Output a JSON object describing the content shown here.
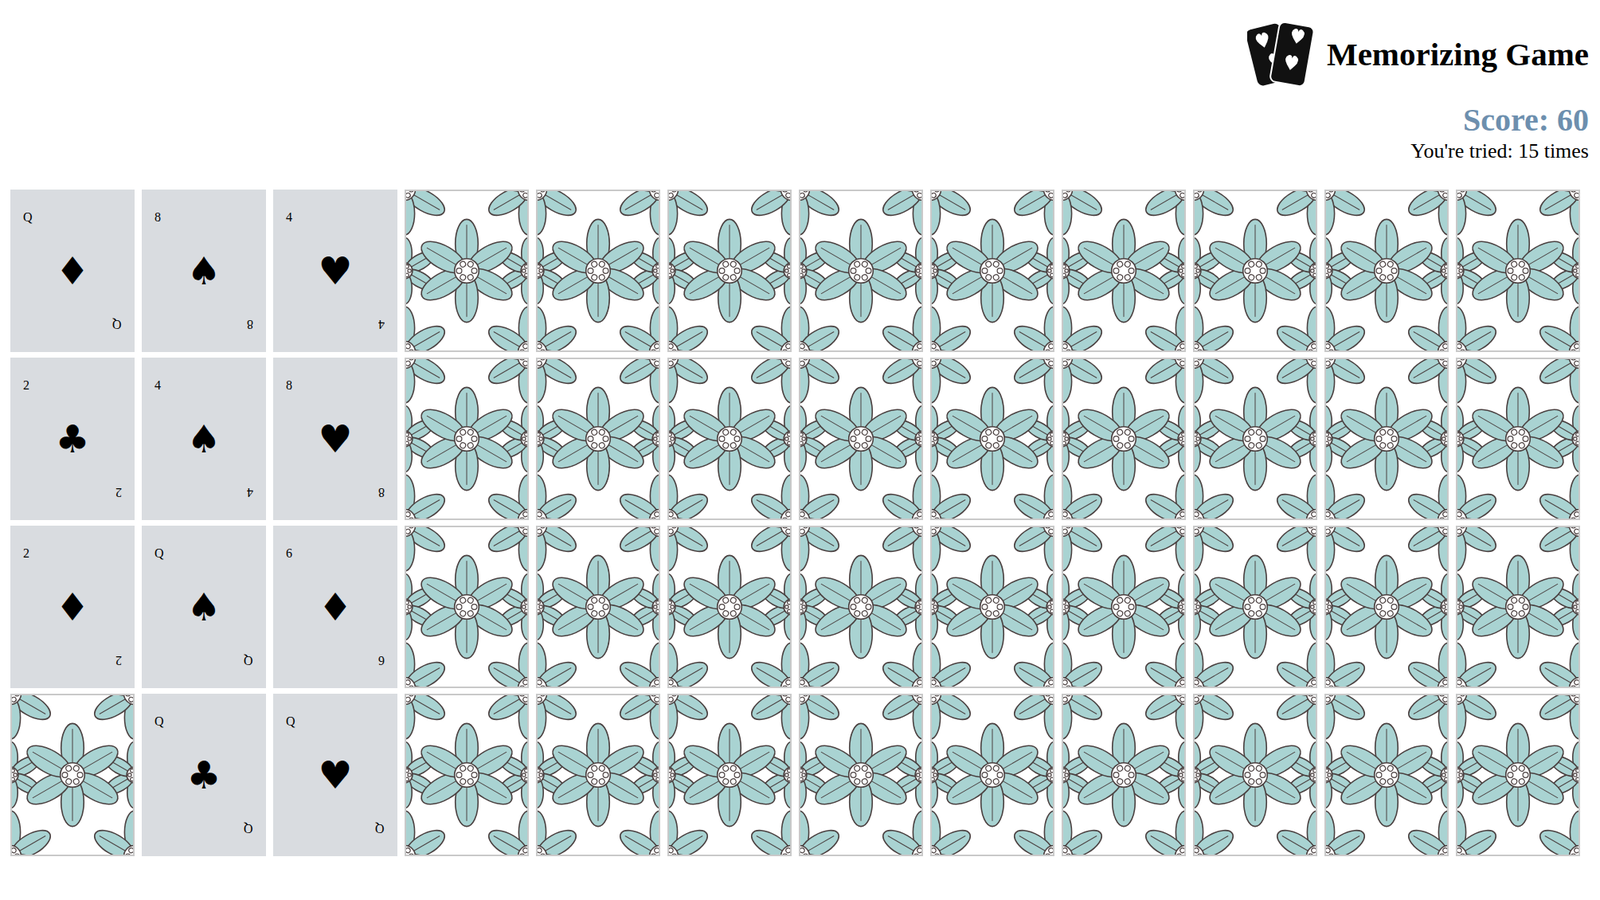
{
  "header": {
    "title": "Memorizing Game",
    "score": "Score: 60",
    "tries": "You're tried: 15 times"
  },
  "cards": [
    {
      "face_up": true,
      "rank": "Q",
      "suit": "♦"
    },
    {
      "face_up": true,
      "rank": "8",
      "suit": "♠"
    },
    {
      "face_up": true,
      "rank": "4",
      "suit": "♥"
    },
    {
      "face_up": false
    },
    {
      "face_up": false
    },
    {
      "face_up": false
    },
    {
      "face_up": false
    },
    {
      "face_up": false
    },
    {
      "face_up": false
    },
    {
      "face_up": false
    },
    {
      "face_up": false
    },
    {
      "face_up": false
    },
    {
      "face_up": true,
      "rank": "2",
      "suit": "♣"
    },
    {
      "face_up": true,
      "rank": "4",
      "suit": "♠"
    },
    {
      "face_up": true,
      "rank": "8",
      "suit": "♥"
    },
    {
      "face_up": false
    },
    {
      "face_up": false
    },
    {
      "face_up": false
    },
    {
      "face_up": false
    },
    {
      "face_up": false
    },
    {
      "face_up": false
    },
    {
      "face_up": false
    },
    {
      "face_up": false
    },
    {
      "face_up": false
    },
    {
      "face_up": true,
      "rank": "2",
      "suit": "♦"
    },
    {
      "face_up": true,
      "rank": "Q",
      "suit": "♠"
    },
    {
      "face_up": true,
      "rank": "6",
      "suit": "♦"
    },
    {
      "face_up": false
    },
    {
      "face_up": false
    },
    {
      "face_up": false
    },
    {
      "face_up": false
    },
    {
      "face_up": false
    },
    {
      "face_up": false
    },
    {
      "face_up": false
    },
    {
      "face_up": false
    },
    {
      "face_up": false
    },
    {
      "face_up": false
    },
    {
      "face_up": true,
      "rank": "Q",
      "suit": "♣"
    },
    {
      "face_up": true,
      "rank": "Q",
      "suit": "♥"
    },
    {
      "face_up": false
    },
    {
      "face_up": false
    },
    {
      "face_up": false
    },
    {
      "face_up": false
    },
    {
      "face_up": false
    },
    {
      "face_up": false
    },
    {
      "face_up": false
    },
    {
      "face_up": false
    },
    {
      "face_up": false
    }
  ]
}
